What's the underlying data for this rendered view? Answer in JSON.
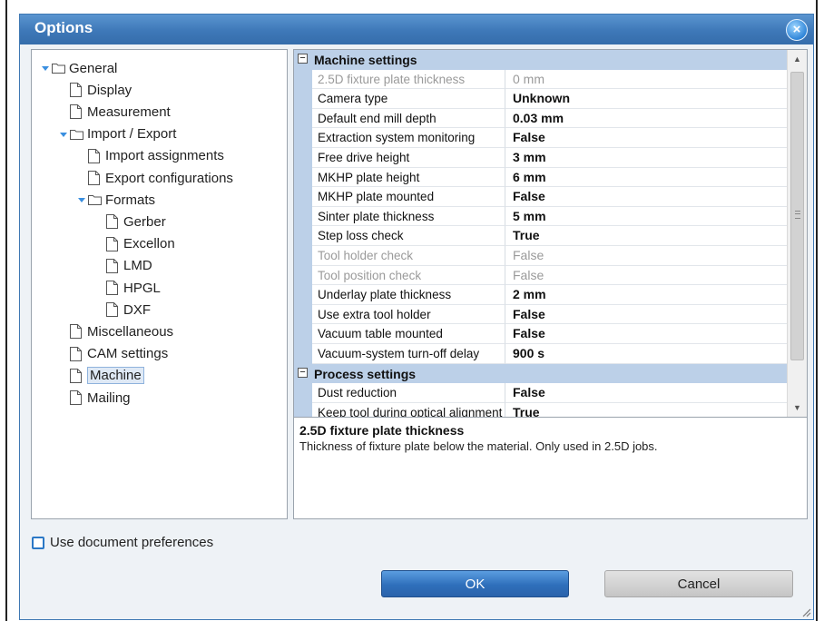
{
  "window": {
    "title": "Options",
    "close_glyph": "×"
  },
  "tree": [
    {
      "label": "General",
      "level": 0,
      "kind": "folder",
      "expanded": true
    },
    {
      "label": "Display",
      "level": 1,
      "kind": "file"
    },
    {
      "label": "Measurement",
      "level": 1,
      "kind": "file"
    },
    {
      "label": "Import / Export",
      "level": 1,
      "kind": "folder",
      "expanded": true
    },
    {
      "label": "Import assignments",
      "level": 2,
      "kind": "file"
    },
    {
      "label": "Export configurations",
      "level": 2,
      "kind": "file"
    },
    {
      "label": "Formats",
      "level": 2,
      "kind": "folder",
      "expanded": true
    },
    {
      "label": "Gerber",
      "level": 3,
      "kind": "file"
    },
    {
      "label": "Excellon",
      "level": 3,
      "kind": "file"
    },
    {
      "label": "LMD",
      "level": 3,
      "kind": "file"
    },
    {
      "label": "HPGL",
      "level": 3,
      "kind": "file"
    },
    {
      "label": "DXF",
      "level": 3,
      "kind": "file"
    },
    {
      "label": "Miscellaneous",
      "level": 1,
      "kind": "file"
    },
    {
      "label": "CAM settings",
      "level": 1,
      "kind": "file"
    },
    {
      "label": "Machine",
      "level": 1,
      "kind": "file",
      "selected": true
    },
    {
      "label": "Mailing",
      "level": 1,
      "kind": "file"
    }
  ],
  "grid": {
    "rows": [
      {
        "type": "category",
        "label": "Machine settings",
        "toggle": "⊟"
      },
      {
        "type": "prop",
        "name": "2.5D fixture plate thickness",
        "value": "0 mm",
        "disabled": true
      },
      {
        "type": "prop",
        "name": "Camera type",
        "value": "Unknown"
      },
      {
        "type": "prop",
        "name": "Default end mill depth",
        "value": "0.03 mm"
      },
      {
        "type": "prop",
        "name": "Extraction system monitoring",
        "value": "False"
      },
      {
        "type": "prop",
        "name": "Free drive height",
        "value": "3 mm"
      },
      {
        "type": "prop",
        "name": "MKHP plate height",
        "value": "6 mm"
      },
      {
        "type": "prop",
        "name": "MKHP plate mounted",
        "value": "False"
      },
      {
        "type": "prop",
        "name": "Sinter plate thickness",
        "value": "5 mm"
      },
      {
        "type": "prop",
        "name": "Step loss check",
        "value": "True"
      },
      {
        "type": "prop",
        "name": "Tool holder check",
        "value": "False",
        "disabled": true
      },
      {
        "type": "prop",
        "name": "Tool position check",
        "value": "False",
        "disabled": true
      },
      {
        "type": "prop",
        "name": "Underlay plate thickness",
        "value": "2 mm"
      },
      {
        "type": "prop",
        "name": "Use extra tool holder",
        "value": "False"
      },
      {
        "type": "prop",
        "name": "Vacuum table mounted",
        "value": "False"
      },
      {
        "type": "prop",
        "name": "Vacuum-system turn-off delay",
        "value": "900 s"
      },
      {
        "type": "category",
        "label": "Process settings",
        "toggle": "⊟"
      },
      {
        "type": "prop",
        "name": "Dust reduction",
        "value": "False"
      },
      {
        "type": "prop",
        "name": "Keep tool during optical alignment",
        "value": "True"
      }
    ]
  },
  "description": {
    "title": "2.5D fixture plate thickness",
    "text": "Thickness of fixture plate below the material. Only used in 2.5D jobs."
  },
  "scrollbar": {
    "up": "▲",
    "down": "▼"
  },
  "use_doc_prefs_label": "Use document preferences",
  "buttons": {
    "ok": "OK",
    "cancel": "Cancel"
  },
  "colors": {
    "title_bar": "#3e78b8",
    "category_bg": "#bcd0e8",
    "ok_button": "#2f6fbb"
  }
}
